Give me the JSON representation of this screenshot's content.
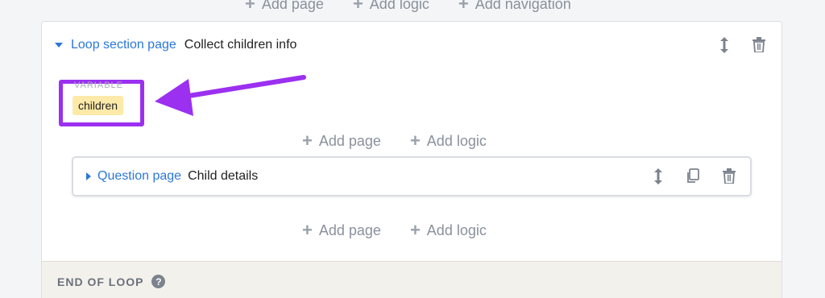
{
  "top_add": {
    "add_page": "Add page",
    "add_logic": "Add logic",
    "add_navigation": "Add navigation"
  },
  "loop_section": {
    "type_label": "Loop section page",
    "title": "Collect children info",
    "variable_label": "VARIABLE",
    "variable_value": "children"
  },
  "mid_add": {
    "add_page": "Add page",
    "add_logic": "Add logic"
  },
  "question_page": {
    "type_label": "Question page",
    "title": "Child details"
  },
  "bottom_add": {
    "add_page": "Add page",
    "add_logic": "Add logic"
  },
  "end_loop": {
    "label": "END OF LOOP",
    "help_symbol": "?"
  },
  "colors": {
    "link_blue": "#2b78d8",
    "highlight_purple": "#9b30f0",
    "variable_chip_bg": "#fde9a8"
  },
  "icons": [
    "plus-icon",
    "caret-down-icon",
    "caret-right-icon",
    "move-vertical-icon",
    "trash-icon",
    "copy-icon",
    "help-icon",
    "arrow-annotation"
  ]
}
